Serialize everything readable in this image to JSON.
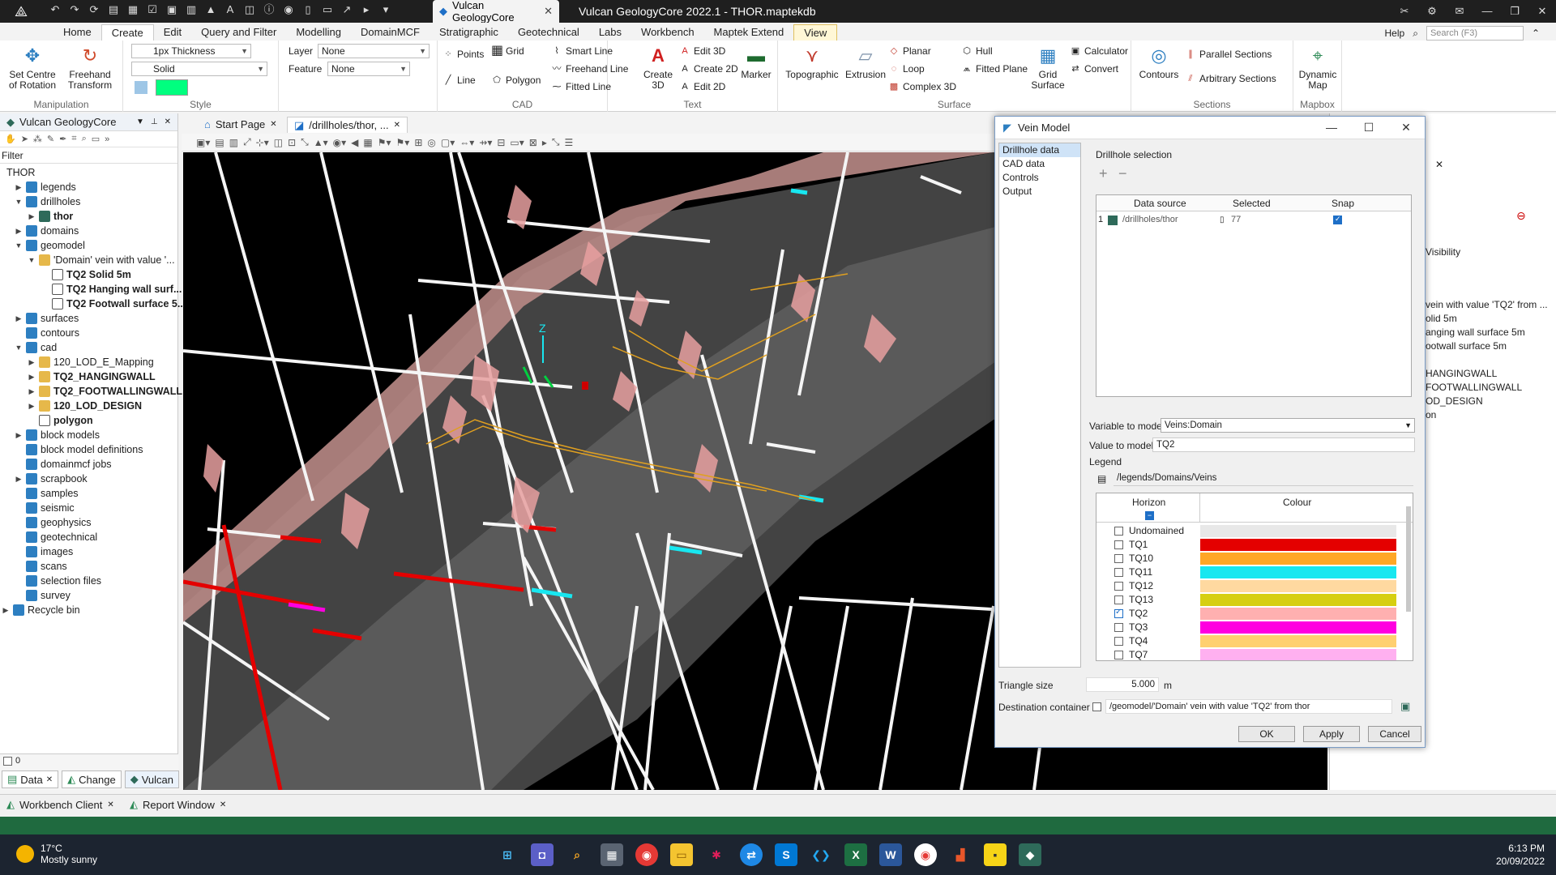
{
  "window": {
    "doc_tab": "Vulcan GeologyCore",
    "title": "Vulcan GeologyCore 2022.1 - THOR.maptekdb"
  },
  "ribbon_tabs": [
    "Home",
    "Create",
    "Edit",
    "Query and Filter",
    "Modelling",
    "DomainMCF",
    "Stratigraphic",
    "Geotechnical",
    "Labs",
    "Workbench",
    "Maptek Extend",
    "View"
  ],
  "ribbon_right": {
    "help": "Help",
    "search_placeholder": "Search (F3)"
  },
  "ribbon": {
    "manipulation": {
      "label": "Manipulation",
      "set_centre": "Set Centre of Rotation",
      "freehand": "Freehand Transform"
    },
    "style": {
      "label": "Style",
      "thickness": "1px Thickness",
      "line_style": "Solid",
      "color": "#00ff7f"
    },
    "layer": {
      "layer_label": "Layer",
      "layer_value": "None",
      "feature_label": "Feature",
      "feature_value": "None"
    },
    "cad": {
      "label": "CAD",
      "points": "Points",
      "grid": "Grid",
      "line": "Line",
      "polygon": "Polygon",
      "smart_line": "Smart Line",
      "freehand_line": "Freehand Line",
      "fitted_line": "Fitted Line"
    },
    "text": {
      "label": "Text",
      "create3d": "Create 3D",
      "edit3d": "Edit 3D",
      "create2d": "Create 2D",
      "edit2d": "Edit 2D",
      "marker": "Marker"
    },
    "surface": {
      "label": "Surface",
      "topographic": "Topographic",
      "extrusion": "Extrusion",
      "planar": "Planar",
      "loop": "Loop",
      "complex3d": "Complex 3D",
      "hull": "Hull",
      "fitted_plane": "Fitted Plane",
      "grid_surface": "Grid Surface",
      "calculator": "Calculator",
      "convert": "Convert"
    },
    "sections": {
      "label": "Sections",
      "contours": "Contours",
      "parallel": "Parallel Sections",
      "arbitrary": "Arbitrary Sections"
    },
    "mapbox": {
      "label": "Mapbox",
      "dynamic_map": "Dynamic Map"
    }
  },
  "left_panel": {
    "title": "Vulcan GeologyCore",
    "filter": "Filter",
    "tree": [
      {
        "label": "THOR",
        "level": 0,
        "icon": "none",
        "exp": ""
      },
      {
        "label": "legends",
        "level": 1,
        "icon": "db",
        "exp": "▶"
      },
      {
        "label": "drillholes",
        "level": 1,
        "icon": "db",
        "exp": "▼"
      },
      {
        "label": "thor",
        "level": 2,
        "icon": "dh",
        "exp": "▶",
        "bold": true
      },
      {
        "label": "domains",
        "level": 1,
        "icon": "db",
        "exp": "▶"
      },
      {
        "label": "geomodel",
        "level": 1,
        "icon": "db",
        "exp": "▼"
      },
      {
        "label": "'Domain' vein with value '...",
        "level": 2,
        "icon": "folder",
        "exp": "▼"
      },
      {
        "label": "TQ2 Solid 5m",
        "level": 3,
        "icon": "obj",
        "exp": "",
        "bold": true
      },
      {
        "label": "TQ2 Hanging wall surf...",
        "level": 3,
        "icon": "obj",
        "exp": "",
        "bold": true
      },
      {
        "label": "TQ2 Footwall surface 5...",
        "level": 3,
        "icon": "obj",
        "exp": "",
        "bold": true
      },
      {
        "label": "surfaces",
        "level": 1,
        "icon": "db",
        "exp": "▶"
      },
      {
        "label": "contours",
        "level": 1,
        "icon": "db",
        "exp": ""
      },
      {
        "label": "cad",
        "level": 1,
        "icon": "db",
        "exp": "▼"
      },
      {
        "label": "120_LOD_E_Mapping",
        "level": 2,
        "icon": "folder",
        "exp": "▶"
      },
      {
        "label": "TQ2_HANGINGWALL",
        "level": 2,
        "icon": "folder",
        "exp": "▶",
        "bold": true
      },
      {
        "label": "TQ2_FOOTWALLINGWALL",
        "level": 2,
        "icon": "folder",
        "exp": "▶",
        "bold": true
      },
      {
        "label": "120_LOD_DESIGN",
        "level": 2,
        "icon": "folder",
        "exp": "▶",
        "bold": true
      },
      {
        "label": "polygon",
        "level": 2,
        "icon": "obj",
        "exp": "",
        "bold": true
      },
      {
        "label": "block models",
        "level": 1,
        "icon": "db",
        "exp": "▶"
      },
      {
        "label": "block model definitions",
        "level": 1,
        "icon": "db",
        "exp": ""
      },
      {
        "label": "domainmcf jobs",
        "level": 1,
        "icon": "db",
        "exp": ""
      },
      {
        "label": "scrapbook",
        "level": 1,
        "icon": "db",
        "exp": "▶"
      },
      {
        "label": "samples",
        "level": 1,
        "icon": "db",
        "exp": ""
      },
      {
        "label": "seismic",
        "level": 1,
        "icon": "db",
        "exp": ""
      },
      {
        "label": "geophysics",
        "level": 1,
        "icon": "db",
        "exp": ""
      },
      {
        "label": "geotechnical",
        "level": 1,
        "icon": "db",
        "exp": ""
      },
      {
        "label": "images",
        "level": 1,
        "icon": "db",
        "exp": ""
      },
      {
        "label": "scans",
        "level": 1,
        "icon": "db",
        "exp": ""
      },
      {
        "label": "selection files",
        "level": 1,
        "icon": "db",
        "exp": ""
      },
      {
        "label": "survey",
        "level": 1,
        "icon": "db",
        "exp": ""
      },
      {
        "label": "Recycle bin",
        "level": 0,
        "icon": "db",
        "exp": "▶"
      }
    ],
    "count": "0",
    "bottom_tabs": [
      "Data",
      "Change",
      "Vulcan"
    ]
  },
  "doc_tabs": [
    "Start Page",
    "/drillholes/thor, ..."
  ],
  "right_panel_text": {
    "visibility": "Visibility",
    "lines": [
      "vein with value 'TQ2' from ...",
      "olid 5m",
      "anging wall surface 5m",
      "ootwall surface 5m",
      "",
      "HANGINGWALL",
      "FOOTWALLINGWALL",
      "OD_DESIGN",
      "on"
    ]
  },
  "dialog": {
    "title": "Vein Model",
    "nav": [
      "Drillhole data",
      "CAD data",
      "Controls",
      "Output"
    ],
    "drillhole_selection": "Drillhole selection",
    "table_headers": [
      "Data source",
      "Selected",
      "Snap"
    ],
    "table_row": {
      "index": "1",
      "source": "/drillholes/thor",
      "selected": "77"
    },
    "variable_label": "Variable to model",
    "variable_value": "Veins:Domain",
    "value_label": "Value to model",
    "value_value": "TQ2",
    "legend_label": "Legend",
    "legend_path": "/legends/Domains/Veins",
    "horizon_header": "Horizon",
    "colour_header": "Colour",
    "horizons": [
      {
        "name": "Undomained",
        "color": "#e8e8e8",
        "checked": false
      },
      {
        "name": "TQ1",
        "color": "#e40000",
        "checked": false
      },
      {
        "name": "TQ10",
        "color": "#ffa726",
        "checked": false
      },
      {
        "name": "TQ11",
        "color": "#18e7f0",
        "checked": false
      },
      {
        "name": "TQ12",
        "color": "#ffd9a0",
        "checked": false
      },
      {
        "name": "TQ13",
        "color": "#d6cf12",
        "checked": false
      },
      {
        "name": "TQ2",
        "color": "#ffb0b0",
        "checked": true
      },
      {
        "name": "TQ3",
        "color": "#ff00e0",
        "checked": false
      },
      {
        "name": "TQ4",
        "color": "#ffd070",
        "checked": false
      },
      {
        "name": "TQ7",
        "color": "#ffb0f0",
        "checked": false
      }
    ],
    "triangle_label": "Triangle size",
    "triangle_value": "5.000",
    "triangle_unit": "m",
    "dest_label": "Destination container",
    "dest_value": "/geomodel/'Domain' vein with value 'TQ2' from thor",
    "ok": "OK",
    "apply": "Apply",
    "cancel": "Cancel"
  },
  "viewport": {
    "axis_label": "Z"
  },
  "bottom_tabs": [
    "Workbench Client",
    "Report Window"
  ],
  "taskbar": {
    "temp": "17°C",
    "weather": "Mostly sunny",
    "time": "6:13 PM",
    "date": "20/09/2022"
  }
}
